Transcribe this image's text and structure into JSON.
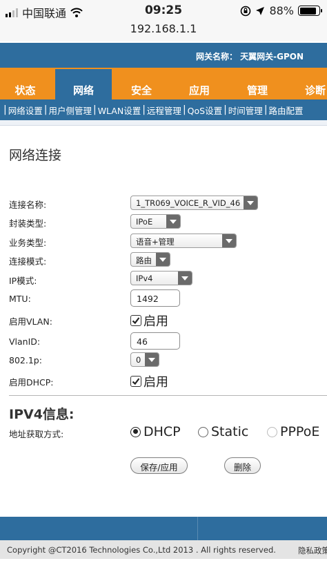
{
  "status_bar": {
    "carrier": "中国联通",
    "time": "09:25",
    "battery_percent": "88%",
    "battery_level": 0.88
  },
  "url_bar": {
    "url": "192.168.1.1"
  },
  "header": {
    "gateway_name": "网关名称： 天翼网关-GPON"
  },
  "main_nav": {
    "tabs": [
      {
        "label": "状态"
      },
      {
        "label": "网络",
        "active": true
      },
      {
        "label": "安全"
      },
      {
        "label": "应用"
      },
      {
        "label": "管理"
      },
      {
        "label": "诊断"
      }
    ]
  },
  "sub_nav": {
    "items": [
      {
        "label": "网络设置"
      },
      {
        "label": "用户侧管理"
      },
      {
        "label": "WLAN设置"
      },
      {
        "label": "远程管理"
      },
      {
        "label": "QoS设置"
      },
      {
        "label": "时间管理"
      },
      {
        "label": "路由配置"
      }
    ]
  },
  "page": {
    "title": "网络连接"
  },
  "form": {
    "connection_name": {
      "label": "连接名称:",
      "value": "1_TR069_VOICE_R_VID_46"
    },
    "encapsulation": {
      "label": "封装类型:",
      "value": "IPoE"
    },
    "service_type": {
      "label": "业务类型:",
      "value": "语音+管理"
    },
    "connection_mode": {
      "label": "连接模式:",
      "value": "路由"
    },
    "ip_mode": {
      "label": "IP模式:",
      "value": "IPv4"
    },
    "mtu": {
      "label": "MTU:",
      "value": "1492"
    },
    "enable_vlan": {
      "label": "启用VLAN:",
      "check_label": "启用",
      "checked": true
    },
    "vlan_id": {
      "label": "VlanID:",
      "value": "46"
    },
    "dot1p": {
      "label": "802.1p:",
      "value": "0"
    },
    "enable_dhcp": {
      "label": "启用DHCP:",
      "check_label": "启用",
      "checked": true
    }
  },
  "ipv4": {
    "title": "IPV4信息:",
    "address_label": "地址获取方式:",
    "options": [
      {
        "label": "DHCP",
        "selected": true
      },
      {
        "label": "Static",
        "selected": false
      },
      {
        "label": "PPPoE",
        "selected": false
      }
    ]
  },
  "buttons": {
    "save": "保存/应用",
    "delete": "删除"
  },
  "footer": {
    "copyright": "Copyright @CT2016 Technologies Co.,Ltd 2013 . All rights reserved.",
    "privacy": "隐私政策"
  },
  "colors": {
    "primary_blue": "#2e6d9e",
    "nav_orange": "#f0901e"
  }
}
